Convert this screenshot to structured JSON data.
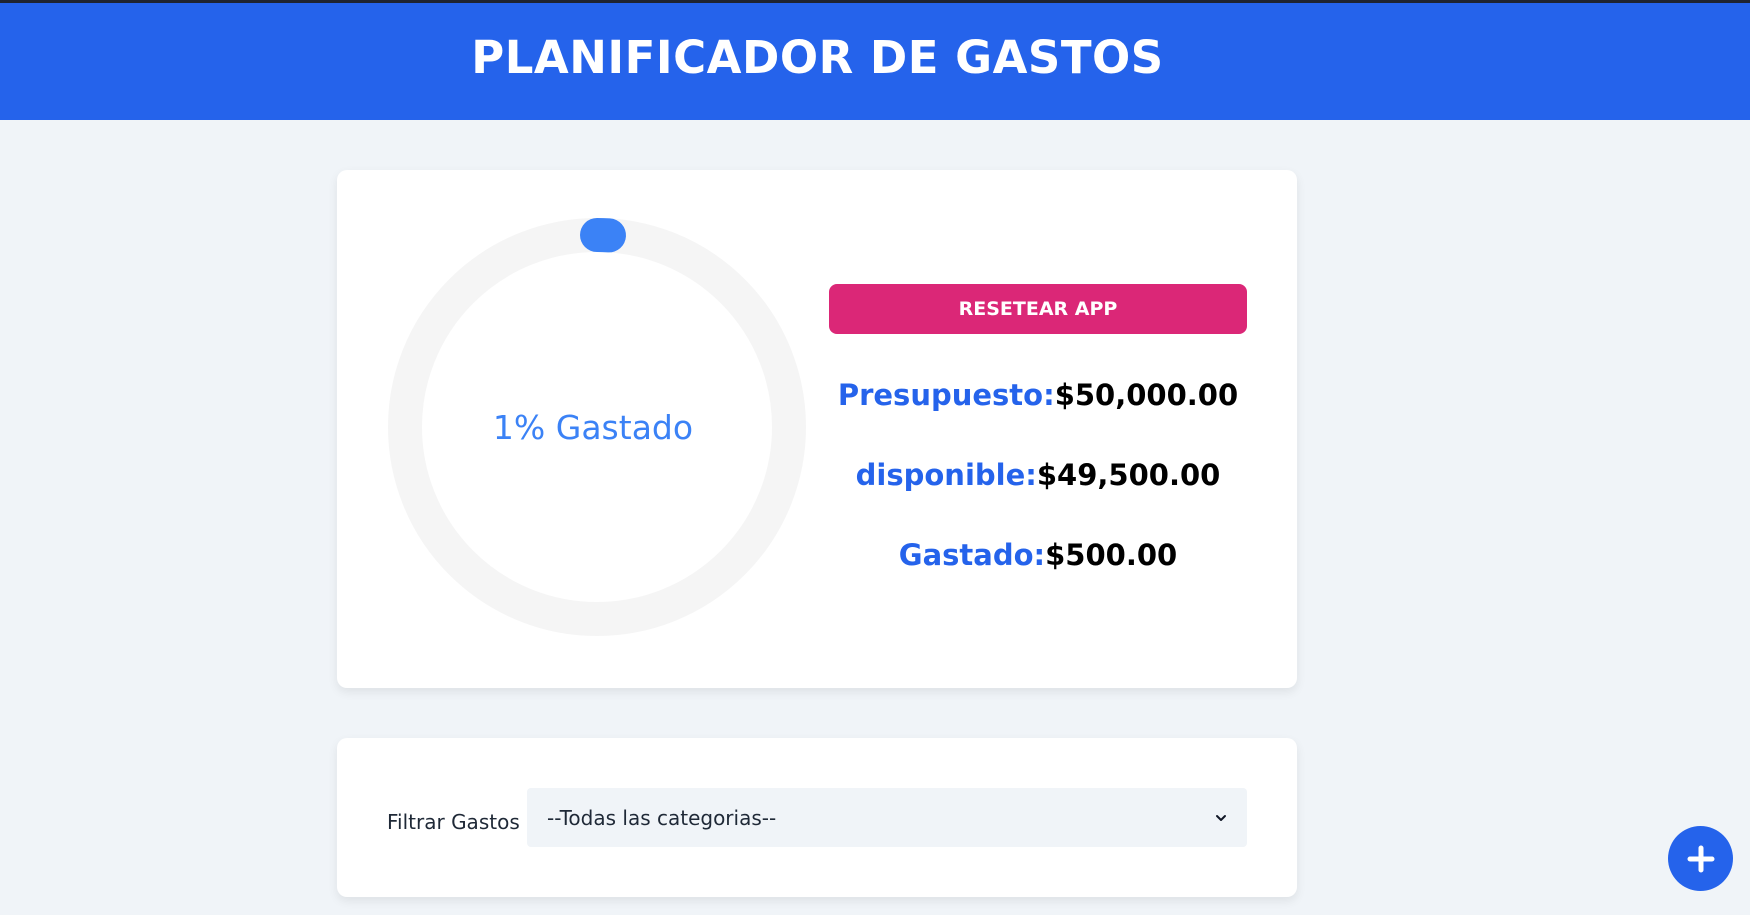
{
  "header": {
    "title": "PLANIFICADOR DE GASTOS"
  },
  "progress": {
    "percent": 1,
    "text": "1% Gastado",
    "track_color": "#f5f5f5",
    "fill_color": "#3b82f6"
  },
  "actions": {
    "reset_label": "RESETEAR APP"
  },
  "stats": {
    "presupuesto": {
      "label": "Presupuesto:",
      "value": "$50,000.00"
    },
    "disponible": {
      "label": "disponible:",
      "value": "$49,500.00"
    },
    "gastado": {
      "label": "Gastado:",
      "value": "$500.00"
    }
  },
  "filter": {
    "label": "Filtrar Gastos",
    "selected": "--Todas las categorias--"
  },
  "colors": {
    "brand": "#2563eb",
    "reset": "#db2777",
    "background": "#f0f4f8"
  },
  "icons": {
    "fab": "plus-icon",
    "select": "chevron-down-icon"
  }
}
